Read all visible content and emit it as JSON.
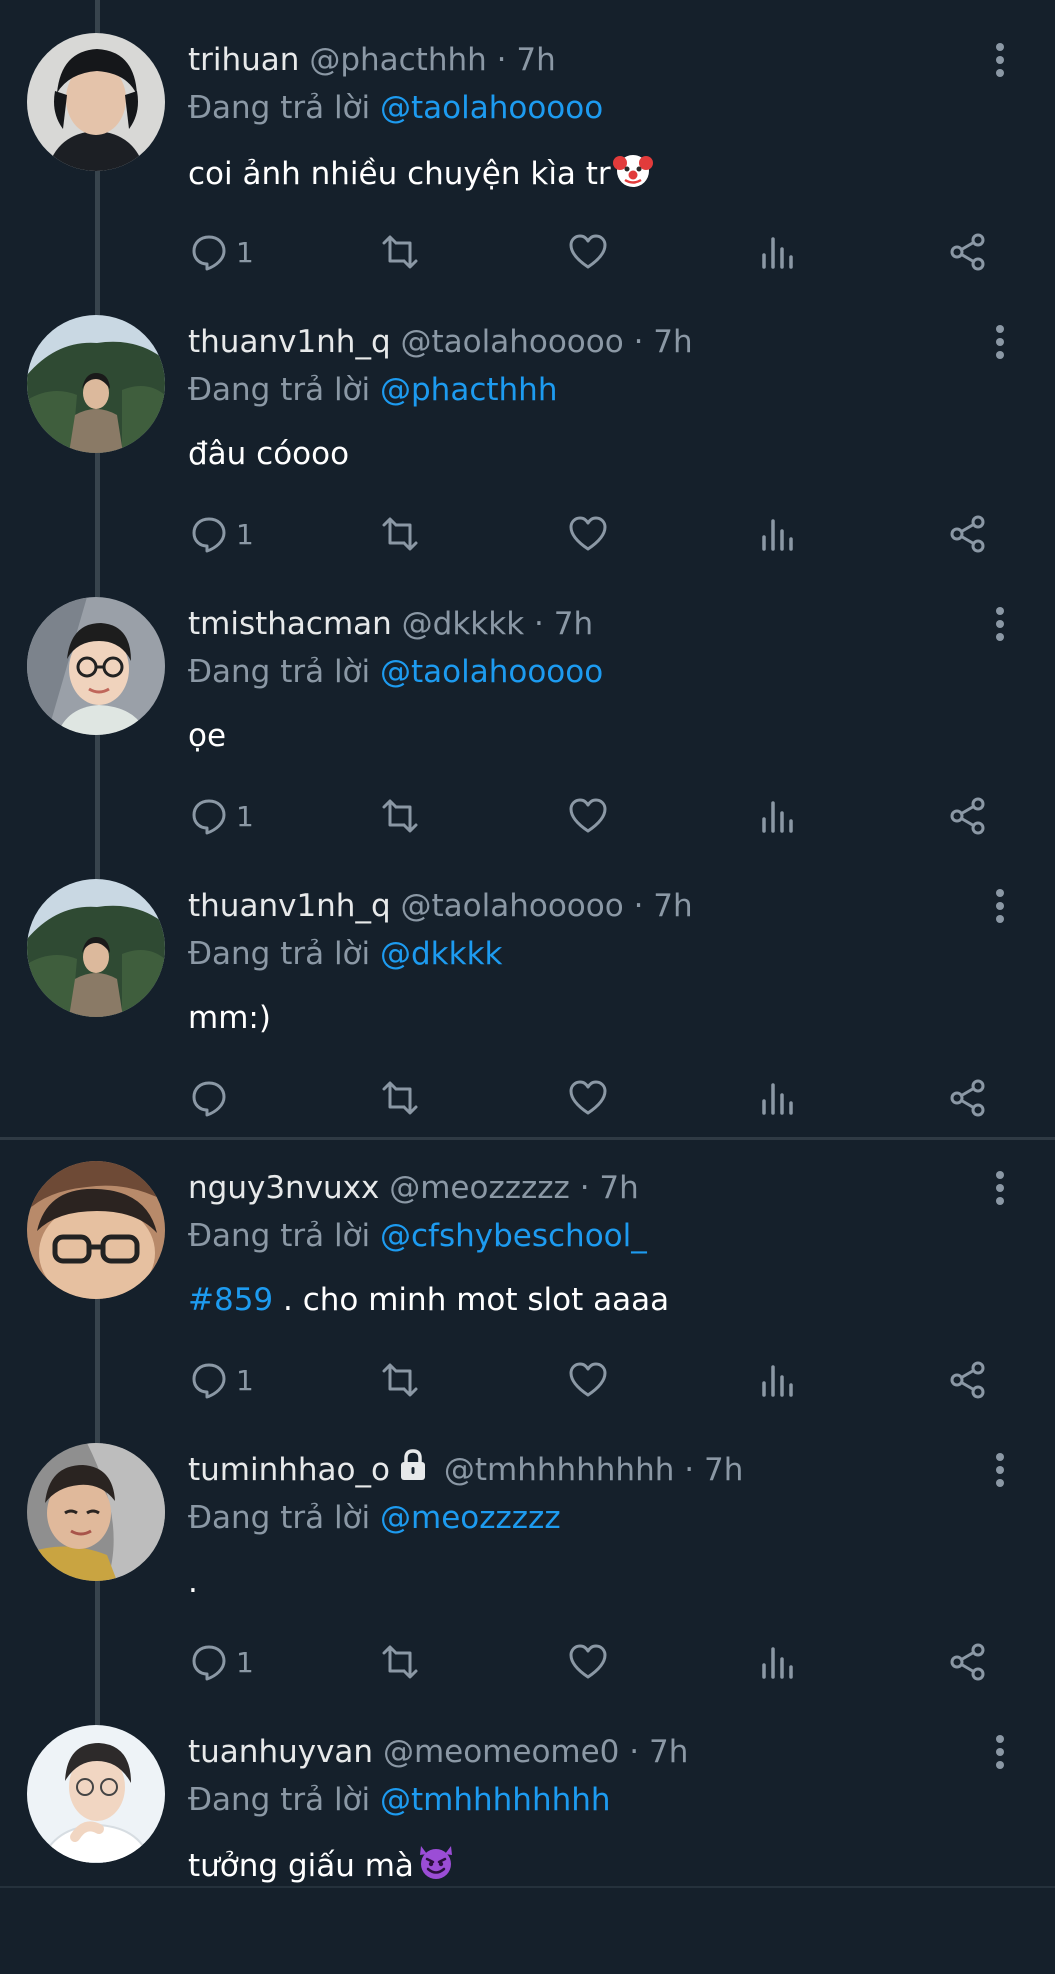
{
  "reply_prefix": "Đang trả lời",
  "colors": {
    "background": "#15202b",
    "accent": "#1d9bf0",
    "muted": "#8b98a5"
  },
  "tweets": [
    {
      "name": "trihuan",
      "handle": "@phacthhh",
      "time": "7h",
      "reply_to": "@taolahooooo",
      "text": "coi ảnh nhiều chuyện kìa tr",
      "emoji": "clown-face",
      "reply_count": "1",
      "locked": false
    },
    {
      "name": "thuanv1nh_q",
      "handle": "@taolahooooo",
      "time": "7h",
      "reply_to": "@phacthhh",
      "text": "đâu cóooo",
      "emoji": "",
      "reply_count": "1",
      "locked": false
    },
    {
      "name": "tmisthacman",
      "handle": "@dkkkk",
      "time": "7h",
      "reply_to": "@taolahooooo",
      "text": "ọe",
      "emoji": "",
      "reply_count": "1",
      "locked": false
    },
    {
      "name": "thuanv1nh_q",
      "handle": "@taolahooooo",
      "time": "7h",
      "reply_to": "@dkkkk",
      "text": "mm:)",
      "emoji": "",
      "reply_count": "",
      "locked": false
    },
    {
      "name": "nguy3nvuxx",
      "handle": "@meozzzzz",
      "time": "7h",
      "reply_to": "@cfshybeschool_",
      "hashtag": "#859",
      "text": " . cho minh mot slot aaaa",
      "emoji": "",
      "reply_count": "1",
      "locked": false
    },
    {
      "name": "tuminhhao_o",
      "handle": "@tmhhhhhhhh",
      "time": "7h",
      "reply_to": "@meozzzzz",
      "text": ".",
      "emoji": "",
      "reply_count": "1",
      "locked": true
    },
    {
      "name": "tuanhuyvan",
      "handle": "@meomeome0",
      "time": "7h",
      "reply_to": "@tmhhhhhhhh",
      "text": "tưởng giấu mà",
      "emoji": "smiling-devil",
      "reply_count": "",
      "locked": false
    }
  ]
}
